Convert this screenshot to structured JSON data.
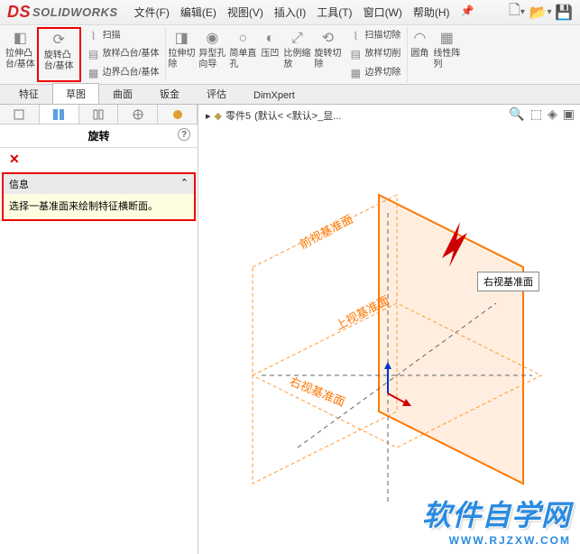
{
  "app": {
    "brand_prefix": "DS",
    "brand": "SOLIDWORKS"
  },
  "menu": {
    "file": "文件(F)",
    "edit": "编辑(E)",
    "view": "视图(V)",
    "insert": "插入(I)",
    "tools": "工具(T)",
    "window": "窗口(W)",
    "help": "帮助(H)"
  },
  "ribbon": {
    "extrude": "拉伸凸\n台/基体",
    "revolve": "旋转凸\n台/基体",
    "sweep": "扫描",
    "loft": "放样凸台/基体",
    "boundary": "边界凸台/基体",
    "extrude_cut": "拉伸切\n除",
    "hole_wizard": "异型孔\n向导",
    "simple_hole": "简单直\n孔",
    "depress": "压凹",
    "scale": "比例缩\n放",
    "revolve_cut": "旋转切\n除",
    "sweep_cut": "扫描切除",
    "loft_cut": "放样切削",
    "boundary_cut": "边界切除",
    "fillet": "圆角",
    "linear_pattern": "线性阵\n列"
  },
  "tabs": {
    "feature": "特征",
    "sketch": "草图",
    "surface": "曲面",
    "sheetmetal": "钣金",
    "evaluate": "评估",
    "dimxpert": "DimXpert"
  },
  "panel": {
    "title": "旋转",
    "info_hdr": "信息",
    "info_msg": "选择一基准面来绘制特征横断面。"
  },
  "breadcrumb": {
    "part": "零件5",
    "config": "(默认< <默认>_显..."
  },
  "planes": {
    "front": "前视基准面",
    "top": "上视基准面",
    "right": "右视基准面"
  },
  "tooltip": "右视基准面",
  "watermark": {
    "main": "软件自学网",
    "sub": "WWW.RJZXW.COM"
  }
}
